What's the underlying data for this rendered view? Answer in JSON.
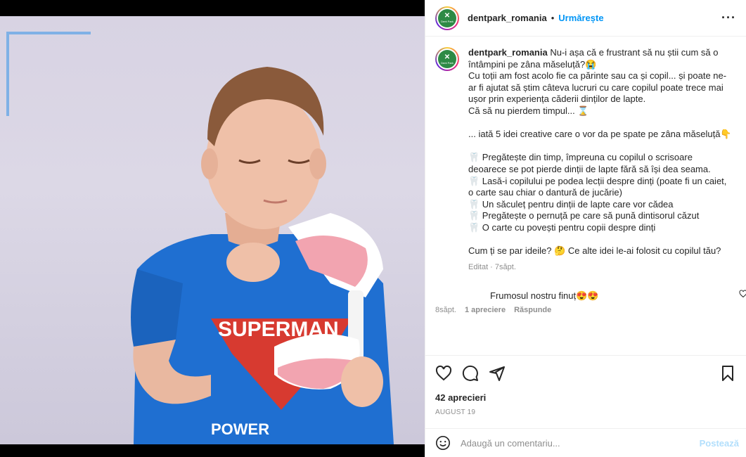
{
  "header": {
    "username": "dentpark_romania",
    "separator": "•",
    "follow_label": "Urmărește",
    "more_label": "···",
    "avatar_text": "Dent Park"
  },
  "caption": {
    "username": "dentpark_romania",
    "lines": [
      "Nu-i așa că e frustrant să nu știi cum să o întâmpini pe zâna măseluță?😭",
      "Cu toții am fost acolo fie ca părinte sau ca și copil... și poate ne-ar fi ajutat să știm câteva lucruri cu care copilul poate trece mai ușor prin experiența căderii dinților de lapte.",
      "Că să nu pierdem timpul... ⌛",
      "",
      "... iată 5 idei creative care o vor da pe spate pe zâna măseluță👇",
      "",
      "🦷 Pregătește din timp, împreuna cu copilul o scrisoare deoarece se pot pierde dinții de lapte fără să își dea seama.",
      "🦷 Lasă-i copilului pe podea lecții despre dinți (poate fi un caiet, o carte sau chiar o dantură de jucărie)",
      "🦷 Un săculeț pentru dinții de lapte care vor cădea",
      "🦷 Pregătește o pernuță pe care să pună dintisorul căzut",
      "🦷 O carte cu povești pentru copii despre dinți",
      "",
      "Cum ți se par ideile? 🤔 Ce alte idei le-ai folosit cu copilul tău?"
    ],
    "meta": "Editat · 7săpt."
  },
  "reply": {
    "text": "Frumosul nostru finuț😍😍",
    "time": "8săpt.",
    "likes": "1 apreciere",
    "reply_label": "Răspunde"
  },
  "actions": {
    "likes": "42 aprecieri",
    "date": "AUGUST 19"
  },
  "comment_box": {
    "placeholder": "Adaugă un comentariu...",
    "post_label": "Postează"
  },
  "colors": {
    "accent": "#0095f6",
    "post_disabled": "#b2dffc",
    "corner_frame": "#7fb1e6",
    "avatar_bg": "#2d8a45"
  },
  "icons": [
    "heart-icon",
    "comment-icon",
    "share-icon",
    "bookmark-icon",
    "emoji-icon",
    "more-icon"
  ]
}
